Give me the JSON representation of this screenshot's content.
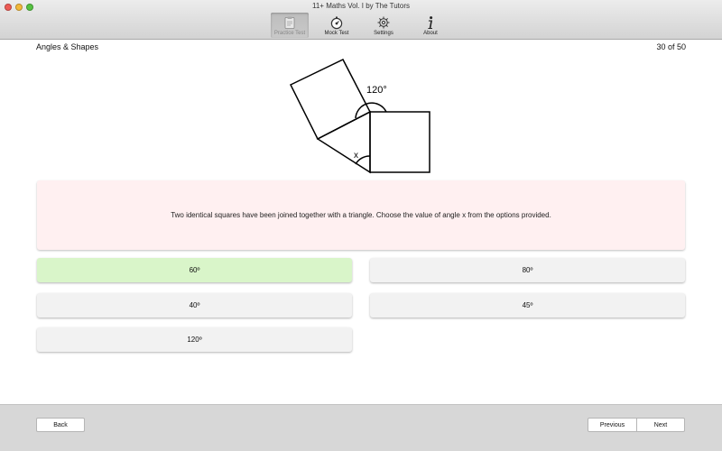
{
  "window": {
    "title": "11+ Maths Vol. I by The Tutors"
  },
  "toolbar": {
    "items": [
      {
        "label": "Practice Test",
        "icon": "clipboard-icon",
        "active": true
      },
      {
        "label": "Mock Test",
        "icon": "stopwatch-icon",
        "active": false
      },
      {
        "label": "Settings",
        "icon": "gear-icon",
        "active": false
      },
      {
        "label": "About",
        "icon": "info-icon",
        "active": false
      }
    ]
  },
  "header": {
    "section": "Angles & Shapes",
    "counter": "30 of 50"
  },
  "figure": {
    "angle_label": "120°",
    "unknown_label": "x"
  },
  "question": {
    "text": "Two identical squares have been joined together with a triangle. Choose the value of angle x from the options provided."
  },
  "options": [
    {
      "label": "60º",
      "state": "correct"
    },
    {
      "label": "80º",
      "state": "default"
    },
    {
      "label": "40º",
      "state": "default"
    },
    {
      "label": "45º",
      "state": "default"
    },
    {
      "label": "120º",
      "state": "default"
    }
  ],
  "footer": {
    "back_label": "Back",
    "previous_label": "Previous",
    "next_label": "Next"
  },
  "colors": {
    "correct_option": "#d9f5c9",
    "question_background": "#fff0f1"
  }
}
